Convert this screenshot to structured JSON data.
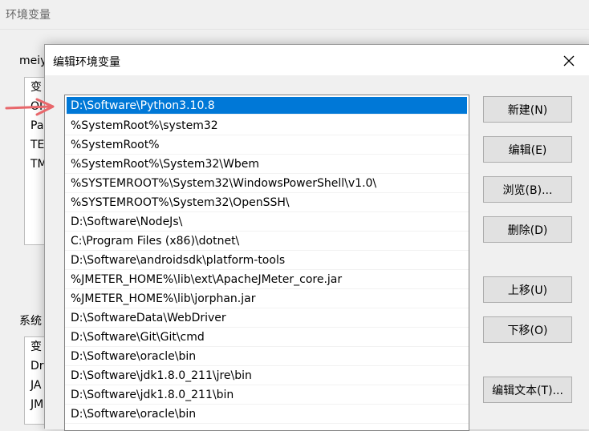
{
  "background_window": {
    "title": "环境变量",
    "user_section_label": "meiy",
    "user_vars": [
      "变",
      "OI",
      "Pa",
      "TE",
      "TM"
    ],
    "system_section_label": "系统",
    "system_vars": [
      "变",
      "Dr",
      "JA",
      "JM"
    ]
  },
  "dialog": {
    "title": "编辑环境变量",
    "paths": [
      "D:\\Software\\Python3.10.8",
      "%SystemRoot%\\system32",
      "%SystemRoot%",
      "%SystemRoot%\\System32\\Wbem",
      "%SYSTEMROOT%\\System32\\WindowsPowerShell\\v1.0\\",
      "%SYSTEMROOT%\\System32\\OpenSSH\\",
      "D:\\Software\\NodeJs\\",
      "C:\\Program Files (x86)\\dotnet\\",
      "D:\\Software\\androidsdk\\platform-tools",
      "%JMETER_HOME%\\lib\\ext\\ApacheJMeter_core.jar",
      "%JMETER_HOME%\\lib\\jorphan.jar",
      "D:\\SoftwareData\\WebDriver",
      "D:\\Software\\Git\\Git\\cmd",
      "D:\\Software\\oracle\\bin",
      "D:\\Software\\jdk1.8.0_211\\jre\\bin",
      "D:\\Software\\jdk1.8.0_211\\bin",
      "D:\\Software\\oracle\\bin"
    ],
    "buttons": {
      "new": "新建(N)",
      "edit": "编辑(E)",
      "browse": "浏览(B)...",
      "delete": "删除(D)",
      "move_up": "上移(U)",
      "move_down": "下移(O)",
      "edit_text": "编辑文本(T)..."
    }
  },
  "colors": {
    "selection": "#0078d7",
    "arrow": "#e8676b"
  }
}
